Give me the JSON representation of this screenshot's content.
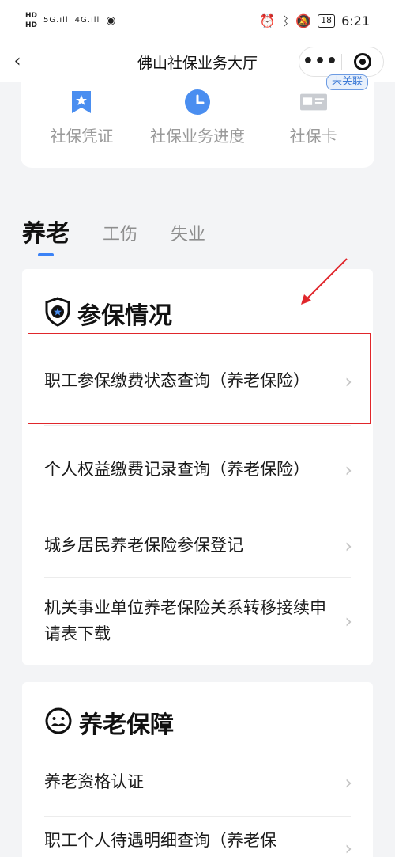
{
  "status_bar": {
    "hd1": "HD",
    "hd2": "HD",
    "signal_5g": "5G",
    "signal_4g": "4G",
    "battery": "18",
    "time": "6:21"
  },
  "navbar": {
    "title": "佛山社保业务大厅",
    "more": "•••"
  },
  "shortcuts": [
    {
      "label": "社保凭证",
      "icon": "certificate-icon"
    },
    {
      "label": "社保业务进度",
      "icon": "clock-icon"
    },
    {
      "label": "社保卡",
      "icon": "card-icon",
      "badge": "未关联"
    }
  ],
  "tabs": [
    "养老",
    "工伤",
    "失业"
  ],
  "sections": [
    {
      "title": "参保情况",
      "icon": "shield-star-icon",
      "items": [
        "职工参保缴费状态查询（养老保险）",
        "个人权益缴费记录查询（养老保险）",
        "城乡居民养老保险参保登记",
        "机关事业单位养老保险关系转移接续申请表下载"
      ]
    },
    {
      "title": "养老保障",
      "icon": "elder-face-icon",
      "items": [
        "养老资格认证",
        "职工个人待遇明细查询（养老保"
      ]
    }
  ],
  "colors": {
    "accent": "#3b82f6",
    "highlight": "#e0262b",
    "icon_blue": "#4a8ef0"
  }
}
